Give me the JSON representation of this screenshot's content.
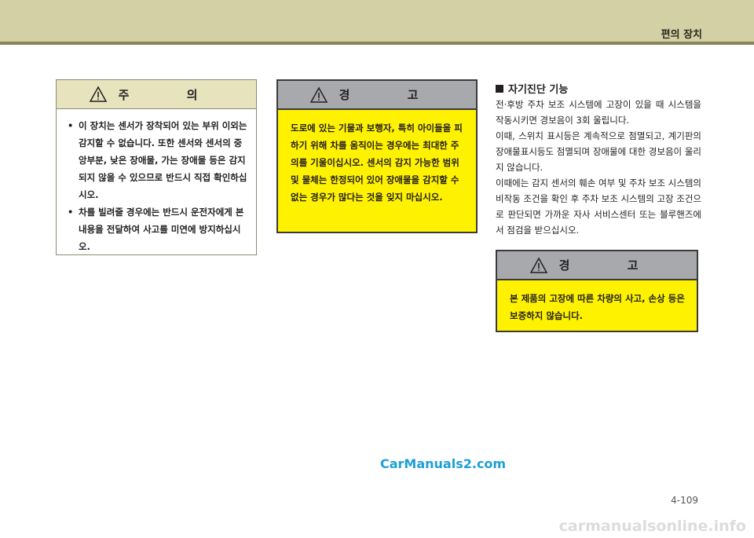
{
  "header": {
    "title": "편의 장치"
  },
  "caution": {
    "title": "주 의",
    "items": [
      "이 장치는 센서가 장착되어 있는 부위 이외는 감지할 수 없습니다. 또한 센서와 센서의 중앙부분, 낮은 장애물, 가는 장애물 등은 감지되지 않을 수 있으므로 반드시 직접 확인하십시오.",
      "차를 빌려줄 경우에는 반드시 운전자에게 본 내용을 전달하여 사고를 미연에 방지하십시오."
    ]
  },
  "warning1": {
    "title": "경 고",
    "text": "도로에 있는 기물과 보행자, 특히 아이들을 피하기 위해 차를 움직이는 경우에는 최대한 주의를 기울이십시오. 센서의 감지 가능한 범위 및 물체는 한정되어 있어 장애물을 감지할 수 없는 경우가 많다는 것을 잊지 마십시오."
  },
  "self_diag": {
    "title": "자기진단 기능",
    "paragraphs": [
      "전·후방 주차 보조 시스템에 고장이 있을 때 시스템을 작동시키면 경보음이 3회 울립니다.",
      "이때, 스위치 표시등은 계속적으로 점멸되고, 계기판의 장애물표시등도 점멸되며 장애물에 대한 경보음이 울리지 않습니다.",
      "이때에는 감지 센서의 훼손 여부 및 주차 보조 시스템의 비작동 조건을 확인 후 주차 보조 시스템의 고장 조건으로 판단되면 가까운 자사 서비스센터 또는 블루핸즈에서 점검을 받으십시오."
    ]
  },
  "warning2": {
    "title": "경 고",
    "text": "본 제품의 고장에 따른 차량의 사고, 손상 등은 보증하지 않습니다."
  },
  "watermark": "CarManuals2.com",
  "page_number": "4-109",
  "footer_watermark": "carmanualsonline.info",
  "colors": {
    "header_band": "#d2d0a4",
    "caution_head": "#e6e3bd",
    "warning_body": "#fff200",
    "warning_head": "#a7a9ac"
  }
}
